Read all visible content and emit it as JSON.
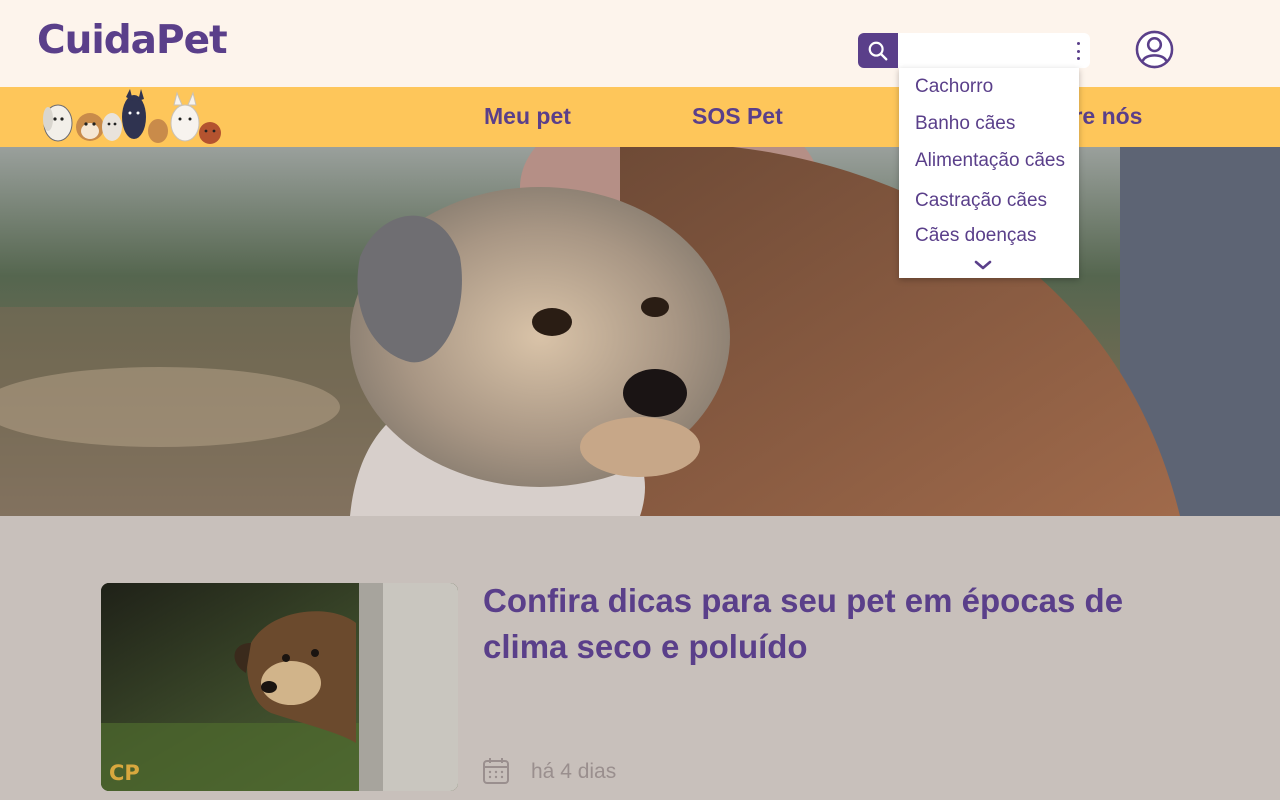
{
  "brand": {
    "name": "CuidaPet",
    "accent": "#5a3f8a",
    "nav_bg": "#fec65a",
    "header_bg": "#fdf4ec"
  },
  "header": {
    "search": {
      "placeholder": "",
      "value": "",
      "icon": "search-icon",
      "menu_icon": "more-vertical-icon"
    },
    "account_icon": "user-circle-icon"
  },
  "nav": {
    "items": [
      {
        "label": "Meu pet"
      },
      {
        "label": "SOS Pet"
      },
      {
        "label": "Sobre nós"
      }
    ]
  },
  "dropdown": {
    "items": [
      {
        "label": "Cachorro"
      },
      {
        "label": "Banho cães"
      },
      {
        "label": "Alimentação cães"
      },
      {
        "label": "Castração cães"
      },
      {
        "label": "Cães doenças"
      }
    ],
    "more_icon": "chevron-down-icon"
  },
  "article": {
    "title": "Confira dicas para seu pet em épocas de clima seco e poluído",
    "date": "há 4 dias",
    "badge": "CP",
    "date_icon": "calendar-icon"
  }
}
